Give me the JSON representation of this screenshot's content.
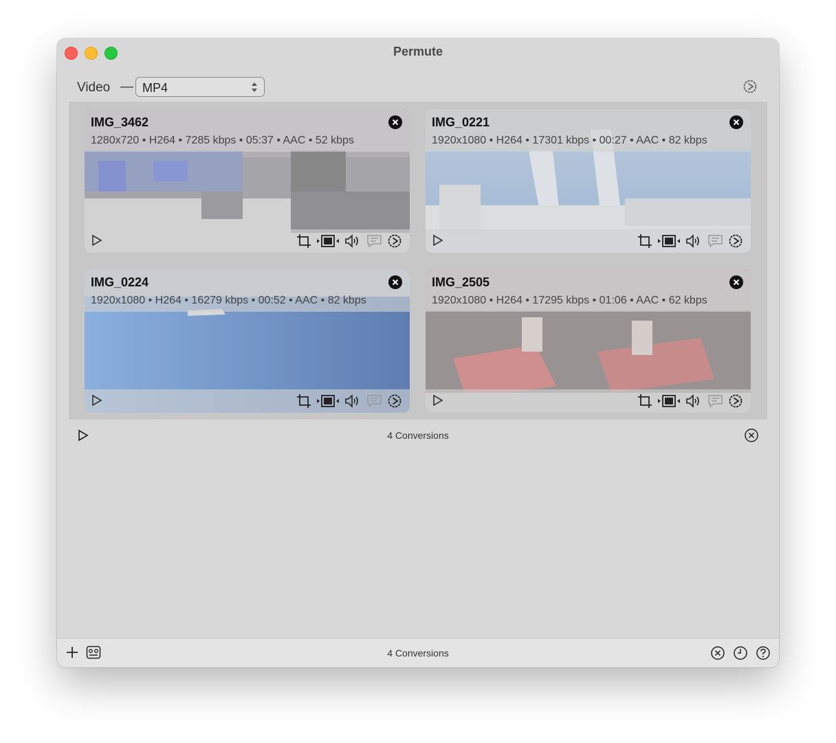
{
  "window": {
    "title": "Permute"
  },
  "toolbar": {
    "type_label": "Video",
    "separator": "—",
    "format_value": "MP4"
  },
  "files": [
    {
      "name": "IMG_3462",
      "meta": "1280x720 • H264 • 7285 kbps • 05:37 • AAC • 52 kbps"
    },
    {
      "name": "IMG_0221",
      "meta": "1920x1080 • H264 • 17301 kbps • 00:27 • AAC • 82 kbps"
    },
    {
      "name": "IMG_0224",
      "meta": "1920x1080 • H264 • 16279 kbps • 00:52 • AAC • 82 kbps"
    },
    {
      "name": "IMG_2505",
      "meta": "1920x1080 • H264 • 17295 kbps • 01:06 • AAC • 62 kbps"
    }
  ],
  "list_footer": {
    "count_label": "4 Conversions"
  },
  "bottom_bar": {
    "count_label": "4 Conversions"
  },
  "icons": {
    "card_controls": [
      "play-icon",
      "crop-icon",
      "trim-icon",
      "audio-icon",
      "subtitles-icon",
      "settings-icon"
    ],
    "bottom": [
      "add-icon",
      "presets-icon",
      "cancel-all-icon",
      "history-icon",
      "help-icon"
    ]
  },
  "colors": {
    "close": "#fe5f57",
    "minimize": "#febc2e",
    "maximize": "#28c840"
  }
}
